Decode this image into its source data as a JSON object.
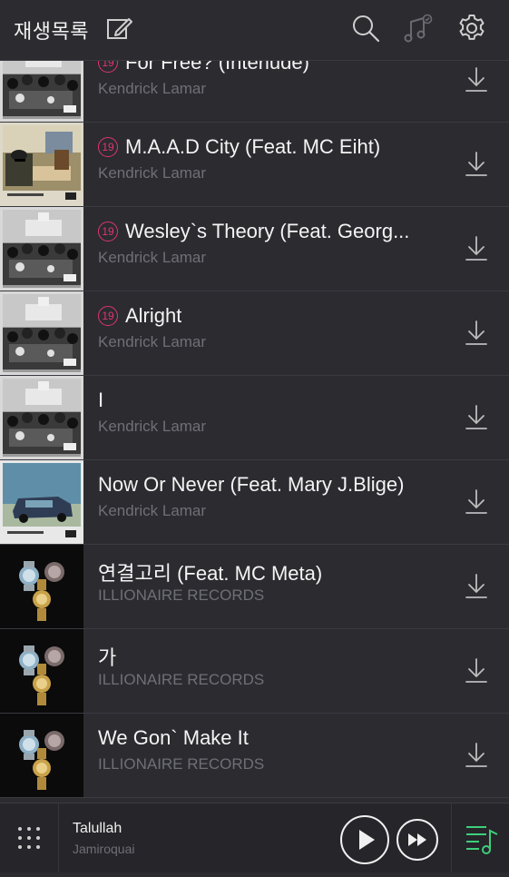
{
  "header": {
    "title": "재생목록",
    "icons": [
      "edit-icon",
      "search-icon",
      "music-filter-icon",
      "settings-icon"
    ]
  },
  "explicit_badge": "19",
  "tracks": [
    {
      "title": "For Free? (Interlude)",
      "artist": "Kendrick Lamar",
      "explicit": true,
      "art": "tpab"
    },
    {
      "title": "M.A.A.D City (Feat. MC Eiht)",
      "artist": "Kendrick Lamar",
      "explicit": true,
      "art": "gkmc"
    },
    {
      "title": "Wesley`s Theory (Feat. Georg...",
      "artist": "Kendrick Lamar",
      "explicit": true,
      "art": "tpab"
    },
    {
      "title": "Alright",
      "artist": "Kendrick Lamar",
      "explicit": true,
      "art": "tpab"
    },
    {
      "title": "I",
      "artist": "Kendrick Lamar",
      "explicit": false,
      "art": "tpab"
    },
    {
      "title": "Now Or Never (Feat. Mary J.Blige)",
      "artist": "Kendrick Lamar",
      "explicit": false,
      "art": "gkmc-van"
    },
    {
      "title": "연결고리 (Feat. MC Meta)",
      "artist": "ILLIONAIRE RECORDS",
      "explicit": false,
      "art": "watches"
    },
    {
      "title": "가",
      "artist": "ILLIONAIRE RECORDS",
      "explicit": false,
      "art": "watches"
    },
    {
      "title": "We Gon` Make It",
      "artist": "ILLIONAIRE RECORDS",
      "explicit": false,
      "art": "watches"
    }
  ],
  "player": {
    "title": "Talullah",
    "artist": "Jamiroquai"
  },
  "colors": {
    "background": "#2b2b30",
    "explicit": "#e0356e",
    "accent_green": "#3ecf7a",
    "secondary_text": "#6f6f76"
  }
}
